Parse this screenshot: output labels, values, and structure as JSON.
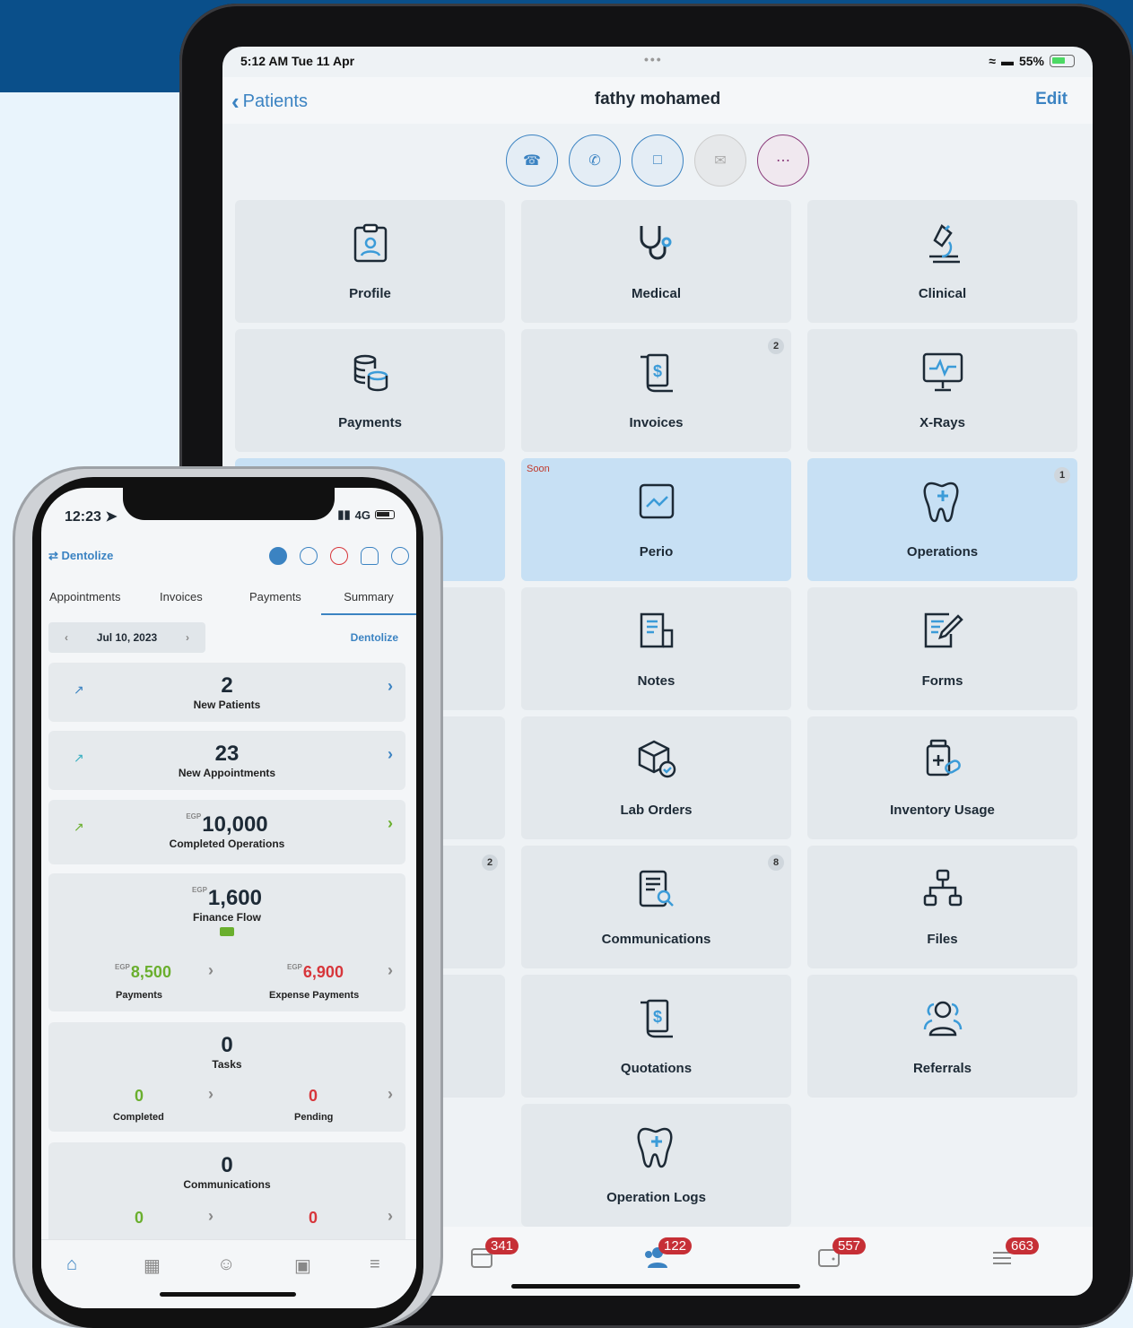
{
  "tablet": {
    "status": {
      "time": "5:12 AM  Tue 11 Apr",
      "battery": "55%"
    },
    "nav": {
      "back_label": "Patients",
      "title": "fathy mohamed",
      "edit_label": "Edit"
    },
    "tiles": [
      {
        "label": "Profile",
        "icon": "clipboard-user-icon"
      },
      {
        "label": "Medical",
        "icon": "stethoscope-icon"
      },
      {
        "label": "Clinical",
        "icon": "microscope-icon"
      },
      {
        "label": "Payments",
        "icon": "coins-icon"
      },
      {
        "label": "Invoices",
        "icon": "invoice-icon",
        "badge": "2"
      },
      {
        "label": "X-Rays",
        "icon": "monitor-pulse-icon"
      },
      {
        "label": "Perio",
        "icon": "chart-icon",
        "soon": "Soon"
      },
      {
        "label": "Operations",
        "icon": "tooth-icon",
        "badge": "1"
      },
      {
        "label": "Notes",
        "icon": "note-icon"
      },
      {
        "label": "Forms",
        "icon": "form-edit-icon"
      },
      {
        "label": "Lab Orders",
        "icon": "package-icon"
      },
      {
        "label": "Inventory Usage",
        "icon": "medicine-icon"
      },
      {
        "label": "Communications",
        "icon": "document-search-icon",
        "badge": "8"
      },
      {
        "label": "Files",
        "icon": "sitemap-icon"
      },
      {
        "label": "Quotations",
        "icon": "invoice-icon"
      },
      {
        "label": "Referrals",
        "icon": "users-icon"
      },
      {
        "label": "Operation Logs",
        "icon": "tooth-icon"
      }
    ],
    "hidden_tile_badge": "2",
    "tabbar": {
      "calendar": "341",
      "patients": "122",
      "wallet": "557",
      "menu": "663"
    }
  },
  "phone": {
    "status": {
      "time": "12:23",
      "network": "4G"
    },
    "brand": "Dentolize",
    "tabs": [
      "Appointments",
      "Invoices",
      "Payments",
      "Summary"
    ],
    "date": "Jul 10, 2023",
    "clinic": "Dentolize",
    "cards": {
      "new_patients": {
        "value": "2",
        "label": "New Patients"
      },
      "new_appointments": {
        "value": "23",
        "label": "New Appointments"
      },
      "completed_operations": {
        "currency": "EGP",
        "value": "10,000",
        "label": "Completed Operations"
      },
      "finance_flow": {
        "currency": "EGP",
        "value": "1,600",
        "label": "Finance Flow",
        "payments": {
          "value": "8,500",
          "label": "Payments"
        },
        "expense": {
          "value": "6,900",
          "label": "Expense Payments"
        }
      },
      "tasks": {
        "value": "0",
        "label": "Tasks",
        "completed": {
          "value": "0",
          "label": "Completed"
        },
        "pending": {
          "value": "0",
          "label": "Pending"
        }
      },
      "communications": {
        "value": "0",
        "label": "Communications",
        "sent": {
          "value": "0"
        },
        "failed": {
          "value": "0"
        }
      }
    }
  }
}
